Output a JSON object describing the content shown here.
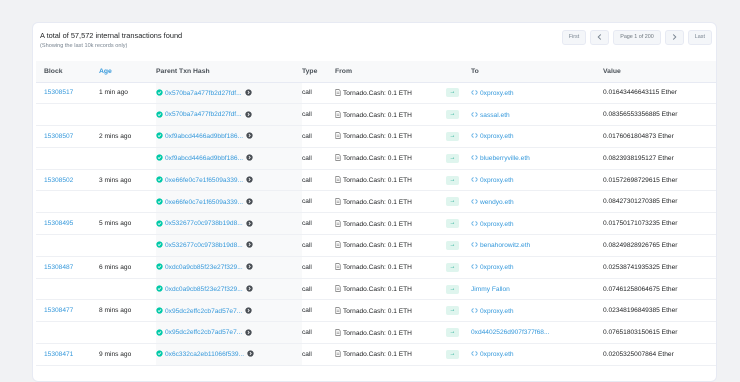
{
  "summary": {
    "title": "A total of 57,572 internal transactions found",
    "subtitle": "(Showing the last 10k records only)"
  },
  "pager": {
    "first": "First",
    "info": "Page 1 of 200",
    "last": "Last"
  },
  "columns": {
    "block": "Block",
    "age": "Age",
    "hash": "Parent Txn Hash",
    "type": "Type",
    "from": "From",
    "to": "To",
    "value": "Value"
  },
  "rows": [
    {
      "block": "15308517",
      "age": "1 min ago",
      "hash": "0x570ba7a477fb2d27fdf...",
      "type": "call",
      "from": "Tornado.Cash: 0.1 ETH",
      "to": "0xproxy.eth",
      "to_contract": true,
      "value": "0.01643446643115 Ether"
    },
    {
      "block": "",
      "age": "",
      "hash": "0x570ba7a477fb2d27fdf...",
      "type": "call",
      "from": "Tornado.Cash: 0.1 ETH",
      "to": "sassal.eth",
      "to_contract": true,
      "value": "0.08356553356885 Ether"
    },
    {
      "block": "15308507",
      "age": "2 mins ago",
      "hash": "0xf9abcd4466ad9bbf186...",
      "type": "call",
      "from": "Tornado.Cash: 0.1 ETH",
      "to": "0xproxy.eth",
      "to_contract": true,
      "value": "0.0176061804873 Ether"
    },
    {
      "block": "",
      "age": "",
      "hash": "0xf9abcd4466ad9bbf186...",
      "type": "call",
      "from": "Tornado.Cash: 0.1 ETH",
      "to": "blueberryville.eth",
      "to_contract": true,
      "value": "0.0823938195127 Ether"
    },
    {
      "block": "15308502",
      "age": "3 mins ago",
      "hash": "0xe66fe0c7e1f6509a339...",
      "type": "call",
      "from": "Tornado.Cash: 0.1 ETH",
      "to": "0xproxy.eth",
      "to_contract": true,
      "value": "0.01572698729615 Ether"
    },
    {
      "block": "",
      "age": "",
      "hash": "0xe66fe0c7e1f6509a339...",
      "type": "call",
      "from": "Tornado.Cash: 0.1 ETH",
      "to": "wendyo.eth",
      "to_contract": true,
      "value": "0.08427301270385 Ether"
    },
    {
      "block": "15308495",
      "age": "5 mins ago",
      "hash": "0x532677c0c9738b19d8...",
      "type": "call",
      "from": "Tornado.Cash: 0.1 ETH",
      "to": "0xproxy.eth",
      "to_contract": true,
      "value": "0.01750171073235 Ether"
    },
    {
      "block": "",
      "age": "",
      "hash": "0x532677c0c9738b19d8...",
      "type": "call",
      "from": "Tornado.Cash: 0.1 ETH",
      "to": "benahorowitz.eth",
      "to_contract": true,
      "value": "0.08249828926765 Ether"
    },
    {
      "block": "15308487",
      "age": "6 mins ago",
      "hash": "0xdc0a9cb85f23e27f329...",
      "type": "call",
      "from": "Tornado.Cash: 0.1 ETH",
      "to": "0xproxy.eth",
      "to_contract": true,
      "value": "0.02538741935325 Ether"
    },
    {
      "block": "",
      "age": "",
      "hash": "0xdc0a9cb85f23e27f329...",
      "type": "call",
      "from": "Tornado.Cash: 0.1 ETH",
      "to": "Jimmy Fallon",
      "to_contract": false,
      "value": "0.07461258064675 Ether"
    },
    {
      "block": "15308477",
      "age": "8 mins ago",
      "hash": "0x95dc2effc2cb7ad57e7...",
      "type": "call",
      "from": "Tornado.Cash: 0.1 ETH",
      "to": "0xproxy.eth",
      "to_contract": true,
      "value": "0.02348196849385 Ether"
    },
    {
      "block": "",
      "age": "",
      "hash": "0x95dc2effc2cb7ad57e7...",
      "type": "call",
      "from": "Tornado.Cash: 0.1 ETH",
      "to": "0xd4402526d907f377f68...",
      "to_contract": false,
      "value": "0.07651803150615 Ether"
    },
    {
      "block": "15308471",
      "age": "9 mins ago",
      "hash": "0x6c332ca2eb11066f539...",
      "type": "call",
      "from": "Tornado.Cash: 0.1 ETH",
      "to": "0xproxy.eth",
      "to_contract": true,
      "value": "0.0205325007864 Ether"
    }
  ]
}
